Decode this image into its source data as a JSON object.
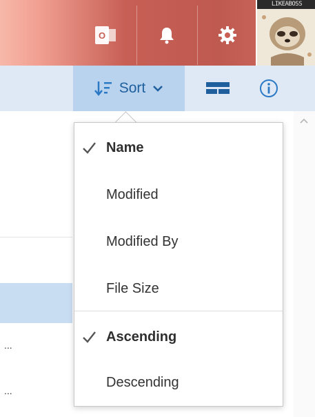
{
  "header": {
    "buttons": [
      {
        "icon": "office-icon"
      },
      {
        "icon": "bell-icon"
      },
      {
        "icon": "gear-icon"
      },
      {
        "icon": "help-icon",
        "label": "?"
      }
    ],
    "avatar_banner": "LIKEABOSS"
  },
  "toolbar": {
    "sort_label": "Sort",
    "sort_icon": "sort-descending-icon",
    "view_icon": "view-toggle-icon",
    "info_icon": "info-icon"
  },
  "sort_menu": {
    "sort_by": [
      {
        "label": "Name",
        "selected": true
      },
      {
        "label": "Modified",
        "selected": false
      },
      {
        "label": "Modified By",
        "selected": false
      },
      {
        "label": "File Size",
        "selected": false
      }
    ],
    "order": [
      {
        "label": "Ascending",
        "selected": true
      },
      {
        "label": "Descending",
        "selected": false
      }
    ]
  },
  "background_rows": [
    {
      "text": "..."
    },
    {
      "text": "..."
    }
  ],
  "colors": {
    "accent": "#2b78c5",
    "sort_button_active": "#b9d3ee",
    "command_bar": "#dfe9f6",
    "selected_row": "#c9ddf2"
  }
}
